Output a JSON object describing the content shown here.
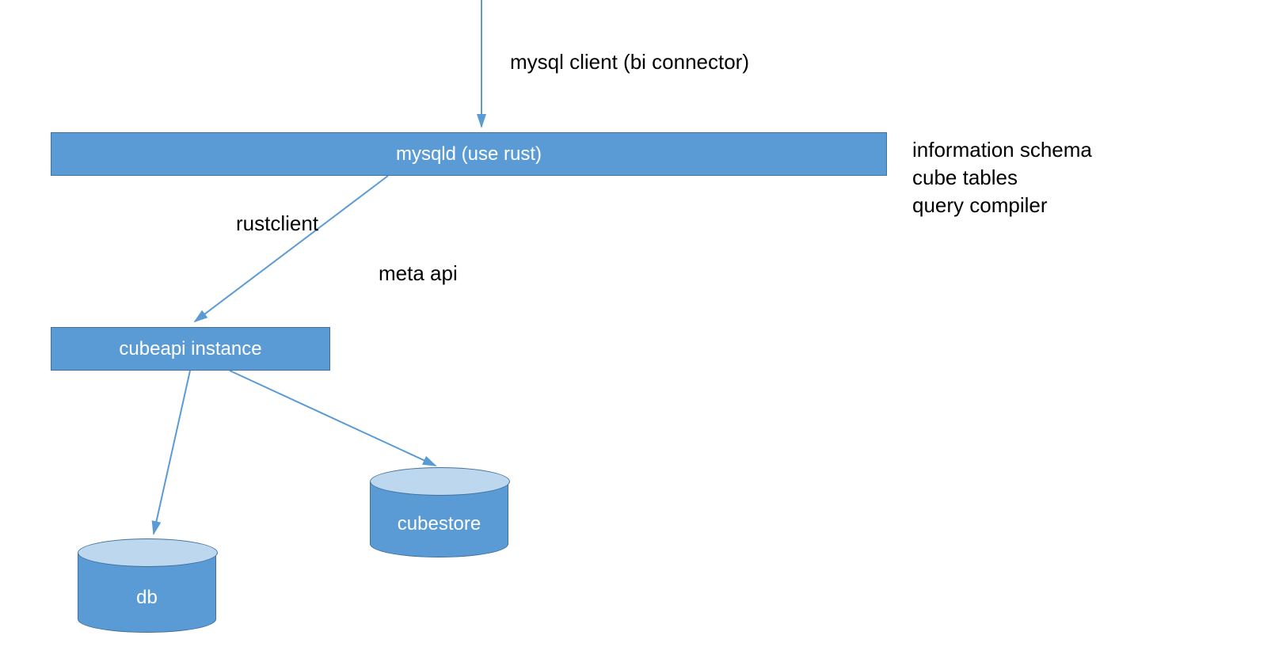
{
  "labels": {
    "mysql_client": "mysql client (bi connector)",
    "rustclient": "rustclient",
    "meta_api": "meta api",
    "side_notes": {
      "line1": "information schema",
      "line2": "cube tables",
      "line3": "query compiler"
    }
  },
  "nodes": {
    "mysqld": "mysqld (use rust)",
    "cubeapi": "cubeapi instance",
    "db": "db",
    "cubestore": "cubestore"
  },
  "edges": [
    {
      "from": "client",
      "to": "mysqld",
      "label": "mysql client (bi connector)"
    },
    {
      "from": "mysqld",
      "to": "cubeapi",
      "label": "rustclient / meta api"
    },
    {
      "from": "cubeapi",
      "to": "db",
      "label": ""
    },
    {
      "from": "cubeapi",
      "to": "cubestore",
      "label": ""
    }
  ],
  "colors": {
    "box_fill": "#5B9BD5",
    "box_border": "#41719C",
    "cylinder_top": "#BDD7EE",
    "arrow": "#5B9BD5"
  }
}
